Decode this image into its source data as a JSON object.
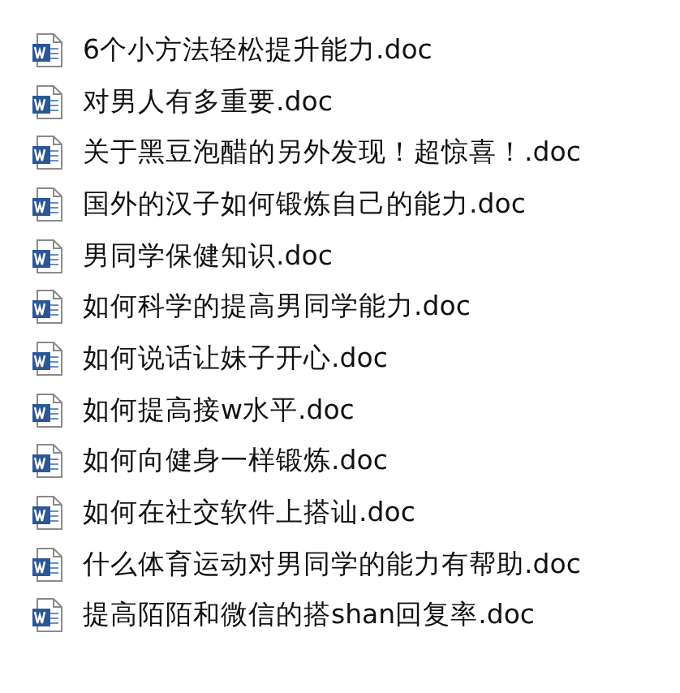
{
  "files": [
    {
      "name": "6个小方法轻松提升能力.doc"
    },
    {
      "name": "对男人有多重要.doc"
    },
    {
      "name": "关于黑豆泡醋的另外发现！超惊喜！.doc"
    },
    {
      "name": "国外的汉子如何锻炼自己的能力.doc"
    },
    {
      "name": "男同学保健知识.doc"
    },
    {
      "name": "如何科学的提高男同学能力.doc"
    },
    {
      "name": "如何说话让妹子开心.doc"
    },
    {
      "name": "如何提高接w水平.doc"
    },
    {
      "name": "如何向健身一样锻炼.doc"
    },
    {
      "name": "如何在社交软件上搭讪.doc"
    },
    {
      "name": "什么体育运动对男同学的能力有帮助.doc"
    },
    {
      "name": "提高陌陌和微信的搭shan回复率.doc"
    }
  ]
}
